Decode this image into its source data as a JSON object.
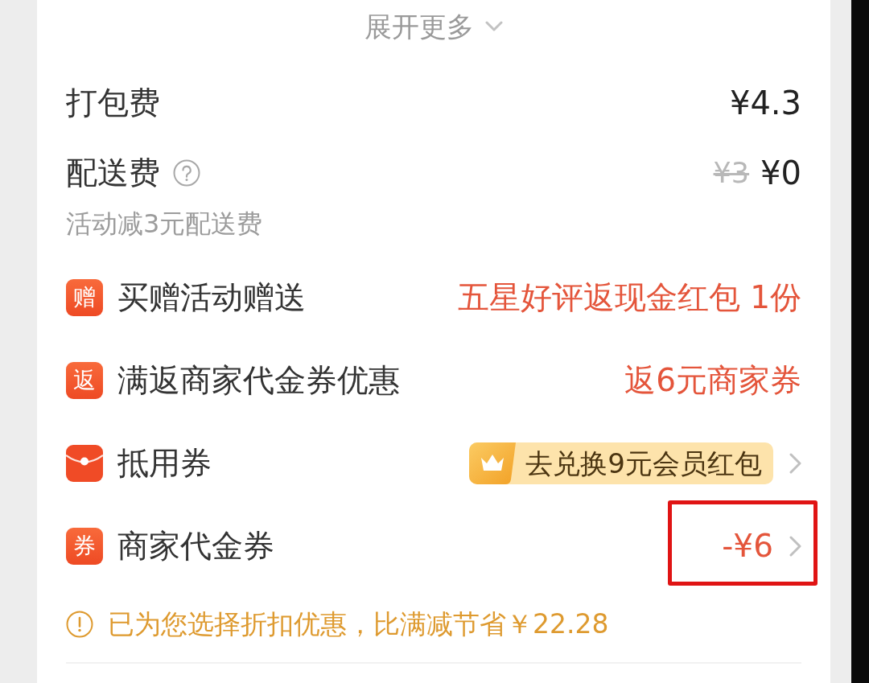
{
  "expand": {
    "label": "展开更多"
  },
  "fees": [
    {
      "kind": "plain",
      "label": "打包费",
      "price": "¥4.3"
    },
    {
      "kind": "discounted",
      "label": "配送费",
      "original_price": "¥3",
      "price": "¥0",
      "note": "活动减3元配送费"
    }
  ],
  "promotions": [
    {
      "kind": "badge",
      "badge": "赠",
      "label": "买赠活动赠送",
      "value": "五星好评返现金红包 1份",
      "clickable": false,
      "highlighted": false
    },
    {
      "kind": "badge",
      "badge": "返",
      "label": "满返商家代金券优惠",
      "value": "返6元商家券",
      "clickable": false,
      "highlighted": false
    },
    {
      "kind": "envelope",
      "label": "抵用券",
      "offer": "去兑换9元会员红包",
      "clickable": true,
      "highlighted": false
    },
    {
      "kind": "badge",
      "badge": "券",
      "label": "商家代金券",
      "value": "-¥6",
      "clickable": true,
      "highlighted": true
    }
  ],
  "notice": "已为您选择折扣优惠，比满减节省￥22.28"
}
